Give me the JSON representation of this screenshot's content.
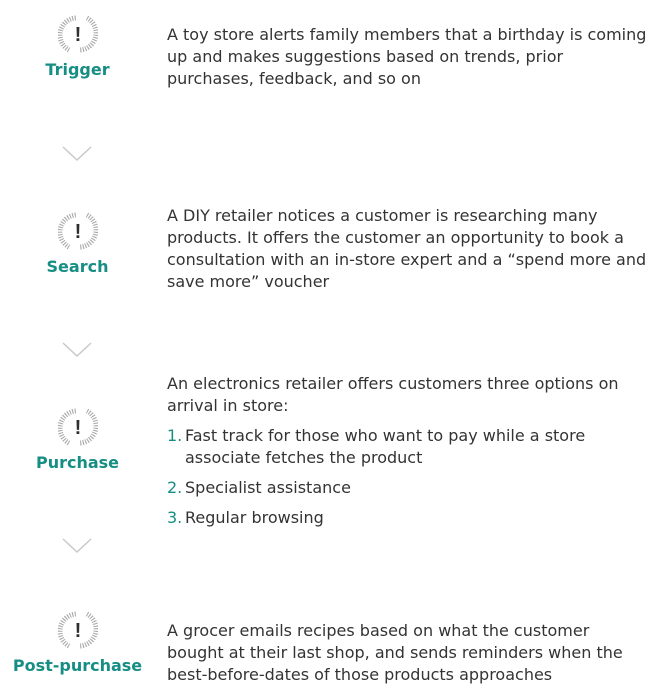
{
  "colors": {
    "accent": "#168e84",
    "chevron": "#c9c9c9",
    "hatch": "#a9a9a9",
    "text": "#333333"
  },
  "badge_icon": "hatched-circle-exclamation-icon",
  "stages": [
    {
      "label": "Trigger",
      "symbol": "!",
      "description": "A toy store alerts family members that a birthday is coming up and makes suggestions based on trends, prior purchases, feedback, and so on"
    },
    {
      "label": "Search",
      "symbol": "!",
      "description": "A DIY retailer notices a customer is researching many products. It offers the customer an opportunity to book a consultation with an in-store expert and a “spend more and save more” voucher"
    },
    {
      "label": "Purchase",
      "symbol": "!",
      "description": "An electronics retailer offers customers three options on arrival in store:",
      "steps": [
        {
          "num": "1.",
          "text": "Fast track for those who want to pay while a store associate fetches the product"
        },
        {
          "num": "2.",
          "text": "Specialist assistance"
        },
        {
          "num": "3.",
          "text": "Regular browsing"
        }
      ]
    },
    {
      "label": "Post-purchase",
      "symbol": "!",
      "description": "A grocer emails recipes based on what the customer bought at their last shop, and sends reminders when the best-before-dates of those products approaches"
    }
  ]
}
